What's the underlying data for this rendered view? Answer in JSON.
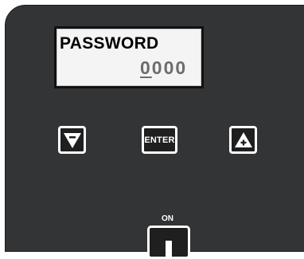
{
  "display": {
    "title": "PASSWORD",
    "value_cursor_digit": "0",
    "value_rest": "000"
  },
  "buttons": {
    "down_icon": "down-triangle-minus-icon",
    "enter_label": "ENTER",
    "up_icon": "up-triangle-plus-icon",
    "power_label": "ON",
    "power_icon": "power-bar-icon"
  },
  "colors": {
    "panel": "#333436",
    "lcd_background": "#f4f4f4",
    "lcd_text": "#000000",
    "lcd_value_text": "#6d6d6d",
    "button_border": "#ffffff",
    "button_fill": "#1f1f20"
  }
}
